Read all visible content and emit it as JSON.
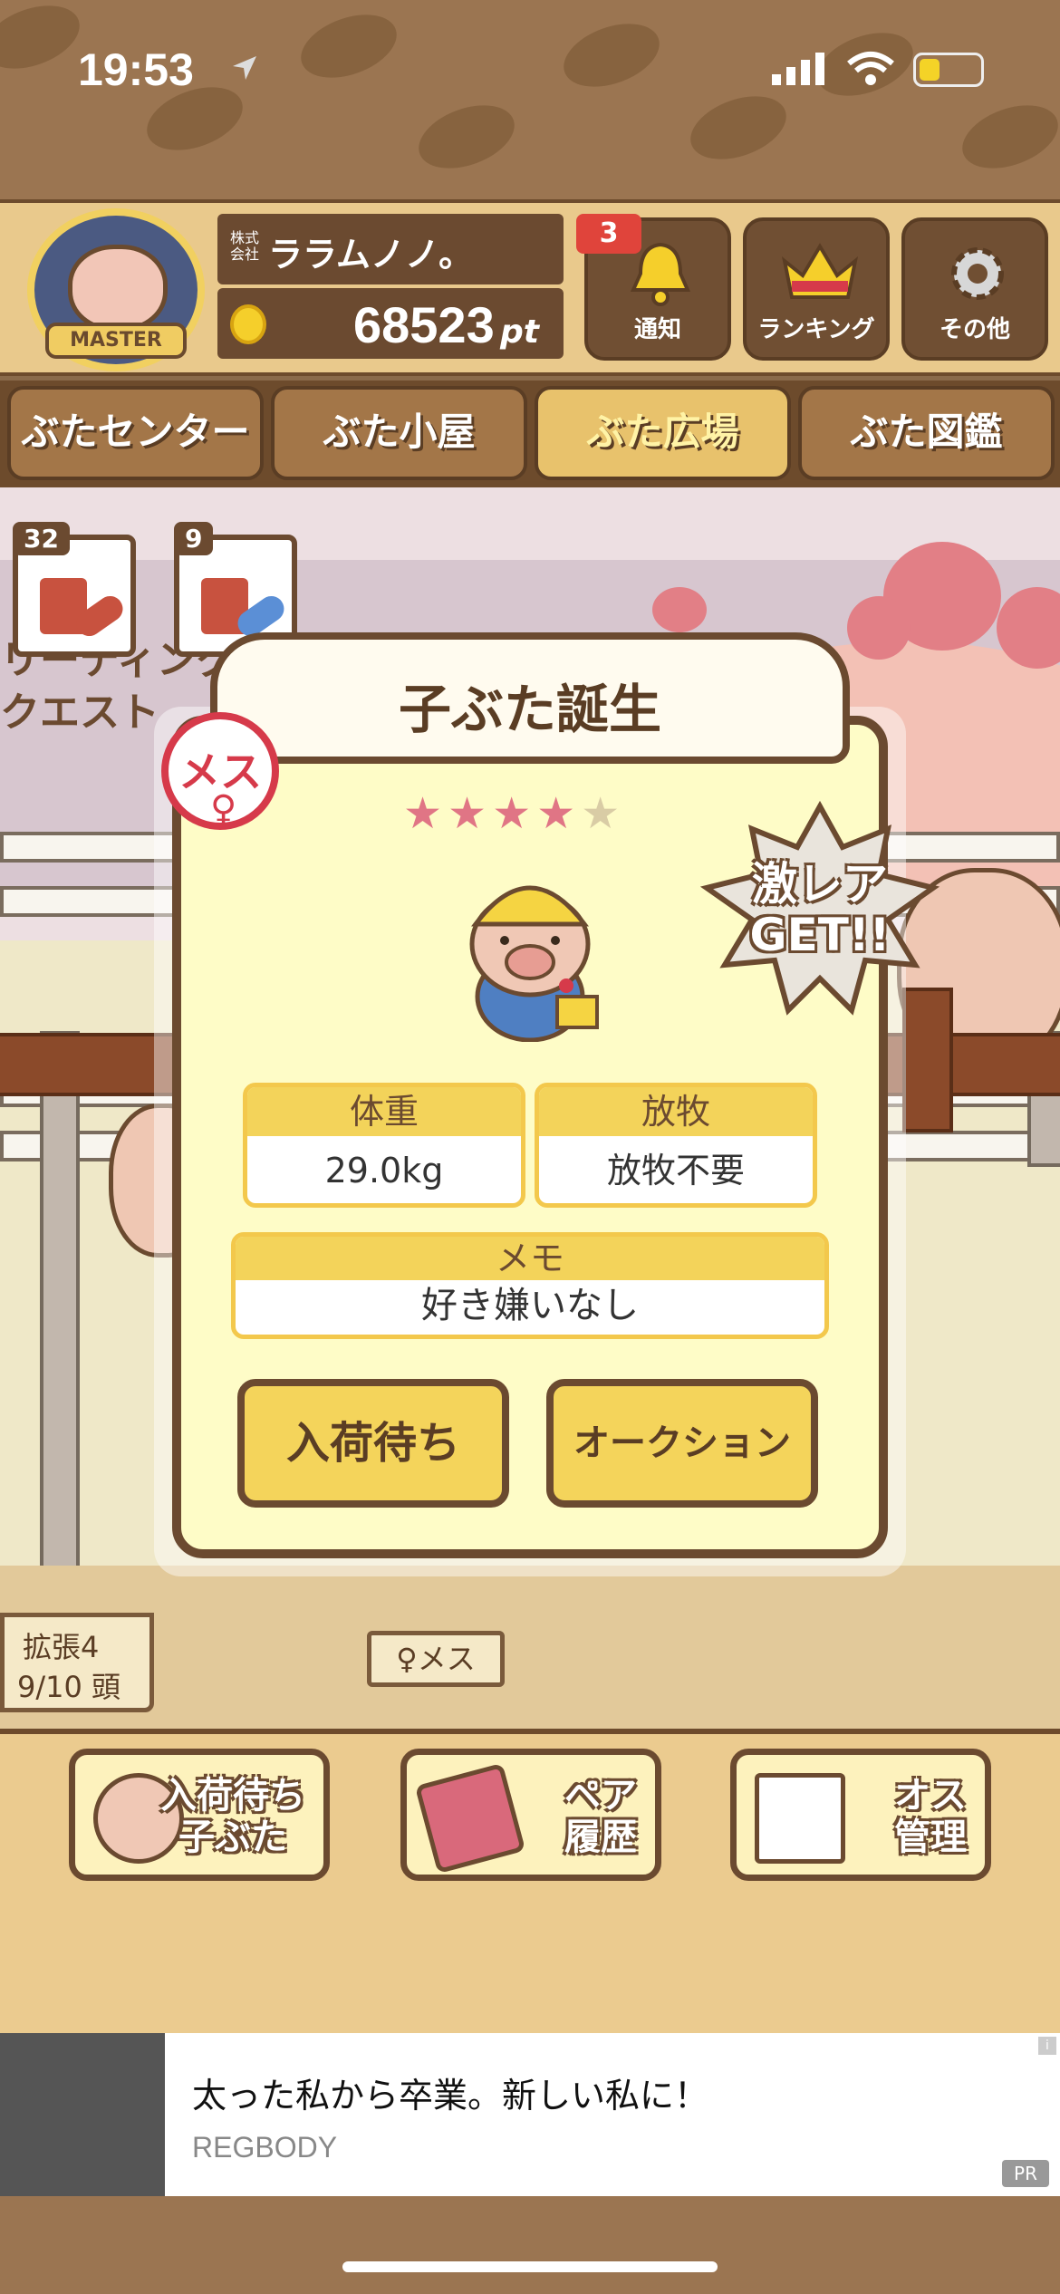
{
  "status_bar": {
    "time": "19:53"
  },
  "header": {
    "master_label": "MASTER",
    "company_prefix": "株式会社",
    "company_name": "ララムノノ。",
    "points_value": "68523",
    "points_unit": "pt",
    "notification_count": "3",
    "buttons": [
      {
        "label": "通知",
        "icon": "bell-icon"
      },
      {
        "label": "ランキング",
        "icon": "crown-icon"
      },
      {
        "label": "その他",
        "icon": "gear-icon"
      }
    ]
  },
  "nav": {
    "tabs": [
      {
        "label": "ぶたセンター"
      },
      {
        "label": "ぶた小屋"
      },
      {
        "label": "ぶた広場",
        "active": true
      },
      {
        "label": "ぶた図鑑"
      }
    ]
  },
  "items": [
    {
      "count": "32",
      "gender": "female",
      "color": "#c8523f"
    },
    {
      "count": "9",
      "gender": "male",
      "color": "#5b8fd6"
    }
  ],
  "scene": {
    "quest_text_line1": "リーディング",
    "quest_text_line2": "クエスト",
    "expansion_label": "拡張4",
    "capacity_label": "9/10 頭",
    "female_sign": "♀メス"
  },
  "modal": {
    "title": "子ぶた誕生",
    "gender_badge": "メス",
    "rarity": 4,
    "rarity_max": 5,
    "rare_banner": "激レア\nGET!!",
    "weight_label": "体重",
    "weight_value": "29.0kg",
    "grazing_label": "放牧",
    "grazing_value": "放牧不要",
    "memo_label": "メモ",
    "memo_value": "好き嫌いなし",
    "button_wait": "入荷待ち",
    "button_auction": "オークション"
  },
  "bottom_buttons": [
    {
      "line1": "入荷待ち",
      "line2": "子ぶた",
      "icon": "pig-face-icon"
    },
    {
      "line1": "ペア",
      "line2": "履歴",
      "icon": "heart-book-icon"
    },
    {
      "line1": "オス",
      "line2": "管理",
      "icon": "male-document-icon"
    }
  ],
  "ad": {
    "title": "太った私から卒業。新しい私に！",
    "brand": "REGBODY",
    "pr": "PR",
    "info": "i"
  },
  "colors": {
    "brown": "#6b4a30",
    "yellow": "#f3d35a",
    "female": "#d63a4a",
    "male": "#5b8fd6"
  }
}
